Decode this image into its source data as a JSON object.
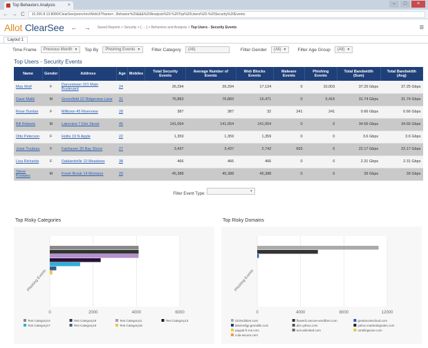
{
  "browser": {
    "tab_title": "Top Behaviors Analysis",
    "tab_close": "×",
    "url": "10.200.8.13:8080/ClearSee/jsrerv/rev/WebUI?frame=...Behavior%20&&&%20Analysis%20-%20Top%20Users%20-%20Security%20Events",
    "nav_back": "←",
    "nav_forward": "→",
    "nav_reload": "C",
    "win_min": "–",
    "win_max": "□",
    "win_close": "×"
  },
  "app": {
    "logo_prefix": "Allot",
    "logo_main": "ClearSee",
    "back": "←",
    "forward": "→",
    "breadcrumb": "Saved Reports > Security > [ ... ] > Behaviors and Analysis > ",
    "breadcrumb_current": "Top Users - Security Events",
    "menu_icon": "≡"
  },
  "layout_tab": "Layout 1",
  "filters": {
    "time_frame_label": "Time Frame",
    "time_frame_value": "Previous Month",
    "top_by_label": "Top By",
    "top_by_value": "Phishing Events",
    "category_label": "Filter Category",
    "category_value": "(All)",
    "gender_label": "Filter Gender",
    "gender_value": "(All)",
    "age_label": "Filter Age Group",
    "age_value": "(All)"
  },
  "table": {
    "title": "Top Users - Security Events",
    "headers": [
      "Name",
      "Gender",
      "Address",
      "Age",
      "Mobiles",
      "Total Security Events",
      "Average Number of Events",
      "Web Blocks Events",
      "Malware Events",
      "Phishing Events",
      "Total Bandwidth (Sum)",
      "Total Bandwidth (Avg)"
    ],
    "rows": [
      [
        "Max Wolf",
        "F",
        "Darcestown 101 Main Boulevard",
        "24",
        "",
        "26,294",
        "26,294",
        "17,124",
        "0",
        "10,003",
        "37.25 Gbps",
        "37.25 Gbps"
      ],
      [
        "Dave Malik",
        "M",
        "Greenfield 22 Ridgeview Lane",
        "31",
        "",
        "76,883",
        "76,883",
        "16,471",
        "0",
        "5,416",
        "31.74 Gbps",
        "31.74 Gbps"
      ],
      [
        "Rose Dunbar",
        "F",
        "Milltown 45 Riverview",
        "28",
        "",
        "387",
        "387",
        "32",
        "241",
        "241",
        "0.66 Gbps",
        "0.66 Gbps"
      ],
      [
        "Bill Roberts",
        "M",
        "Lakeview 7 Elm Street",
        "45",
        "",
        "141,054",
        "141,054",
        "141,054",
        "0",
        "0",
        "34.66 Gbps",
        "34.66 Gbps"
      ],
      [
        "Otto Peterson",
        "F",
        "Hollis 19 N Apple",
        "22",
        "",
        "1,359",
        "1,359",
        "1,359",
        "0",
        "0",
        "3.6 Gbps",
        "3.6 Gbps"
      ],
      [
        "Josie Trudeau",
        "F",
        "Fairhaven 30 Bay Shore",
        "27",
        "",
        "3,437",
        "3,437",
        "2,742",
        "693",
        "0",
        "22.17 Gbps",
        "22.17 Gbps"
      ],
      [
        "Lisa Richards",
        "F",
        "Oaklandville 10 Meadows",
        "38",
        "",
        "466",
        "466",
        "466",
        "0",
        "0",
        "2.31 Gbps",
        "2.31 Gbps"
      ],
      [
        "Steve Knowles",
        "M",
        "Fresh Brook 14 Morrison",
        "29",
        "",
        "45,388",
        "45,388",
        "45,388",
        "0",
        "0",
        "39 Gbps",
        "39 Gbps"
      ]
    ]
  },
  "event_filter": {
    "label": "Filter Event Type:",
    "value": "",
    "caret": "▾"
  },
  "chart_data": [
    {
      "type": "bar",
      "orientation": "horizontal",
      "title": "Top Risky Categories",
      "ylabel": "Phishing Events",
      "xlabel": "",
      "xlim": [
        0,
        6000
      ],
      "xticks": [
        "0",
        "2000",
        "4000",
        "6000"
      ],
      "series": [
        {
          "name": "Test Category14",
          "value": 4100,
          "color": "#888888"
        },
        {
          "name": "Test Category19",
          "value": 4100,
          "color": "#333333"
        },
        {
          "name": "Test Category11",
          "value": 4100,
          "color": "#b48fd0"
        },
        {
          "name": "Test Category13",
          "value": 2350,
          "color": "#2a1036"
        },
        {
          "name": "Test Category17",
          "value": 1400,
          "color": "#2cb0d8"
        },
        {
          "name": "Test Category16",
          "value": 300,
          "color": "#3c5a8c"
        },
        {
          "name": "Test Category18",
          "value": 120,
          "color": "#e8c84a"
        }
      ],
      "legend": [
        "Test Category14",
        "Test Category19",
        "Test Category11",
        "Test Category13",
        "Test Category17",
        "Test Category16",
        "Test Category18"
      ]
    },
    {
      "type": "bar",
      "orientation": "horizontal",
      "title": "Top Risky Domains",
      "ylabel": "Phishing Events",
      "xlabel": "",
      "xlim": [
        0,
        12000
      ],
      "xticks": [
        "0",
        "4000",
        "8000",
        "12000"
      ],
      "series": [
        {
          "name": "clickndlulert.com",
          "value": 11200,
          "color": "#aaaaaa"
        },
        {
          "name": "flowerl1.secure-wordfren.com",
          "value": 5600,
          "color": "#333333"
        },
        {
          "name": "greatmoviecloud.com",
          "value": 150,
          "color": "#2a5db0"
        },
        {
          "name": "k8s4nvfgp.gemaille.com",
          "value": 0,
          "color": "#1f3f78"
        },
        {
          "name": "abc-yahoo.com",
          "value": 0,
          "color": "#555555"
        },
        {
          "name": "yahoo-marketingrules.com",
          "value": 0,
          "color": "#222222"
        },
        {
          "name": "paypal-fr-ms.com",
          "value": 0,
          "color": "#e8c84a"
        },
        {
          "name": "aol-unlimited.com",
          "value": 0,
          "color": "#666666"
        },
        {
          "name": "omelingsone.com",
          "value": 0,
          "color": "#d0d040"
        },
        {
          "name": "cola-secure.com",
          "value": 0,
          "color": "#e8a040"
        }
      ],
      "legend": [
        "clickndlulert.com",
        "flowerl1.secure-wordfren.com",
        "greatmoviecloud.com",
        "k8s4nvfgp.gemaille.com",
        "abc-yahoo.com",
        "yahoo-marketingrules.com",
        "paypal-fr-ms.com",
        "aol-unlimited.com",
        "omelingsone.com",
        "cola-secure.com"
      ]
    }
  ]
}
